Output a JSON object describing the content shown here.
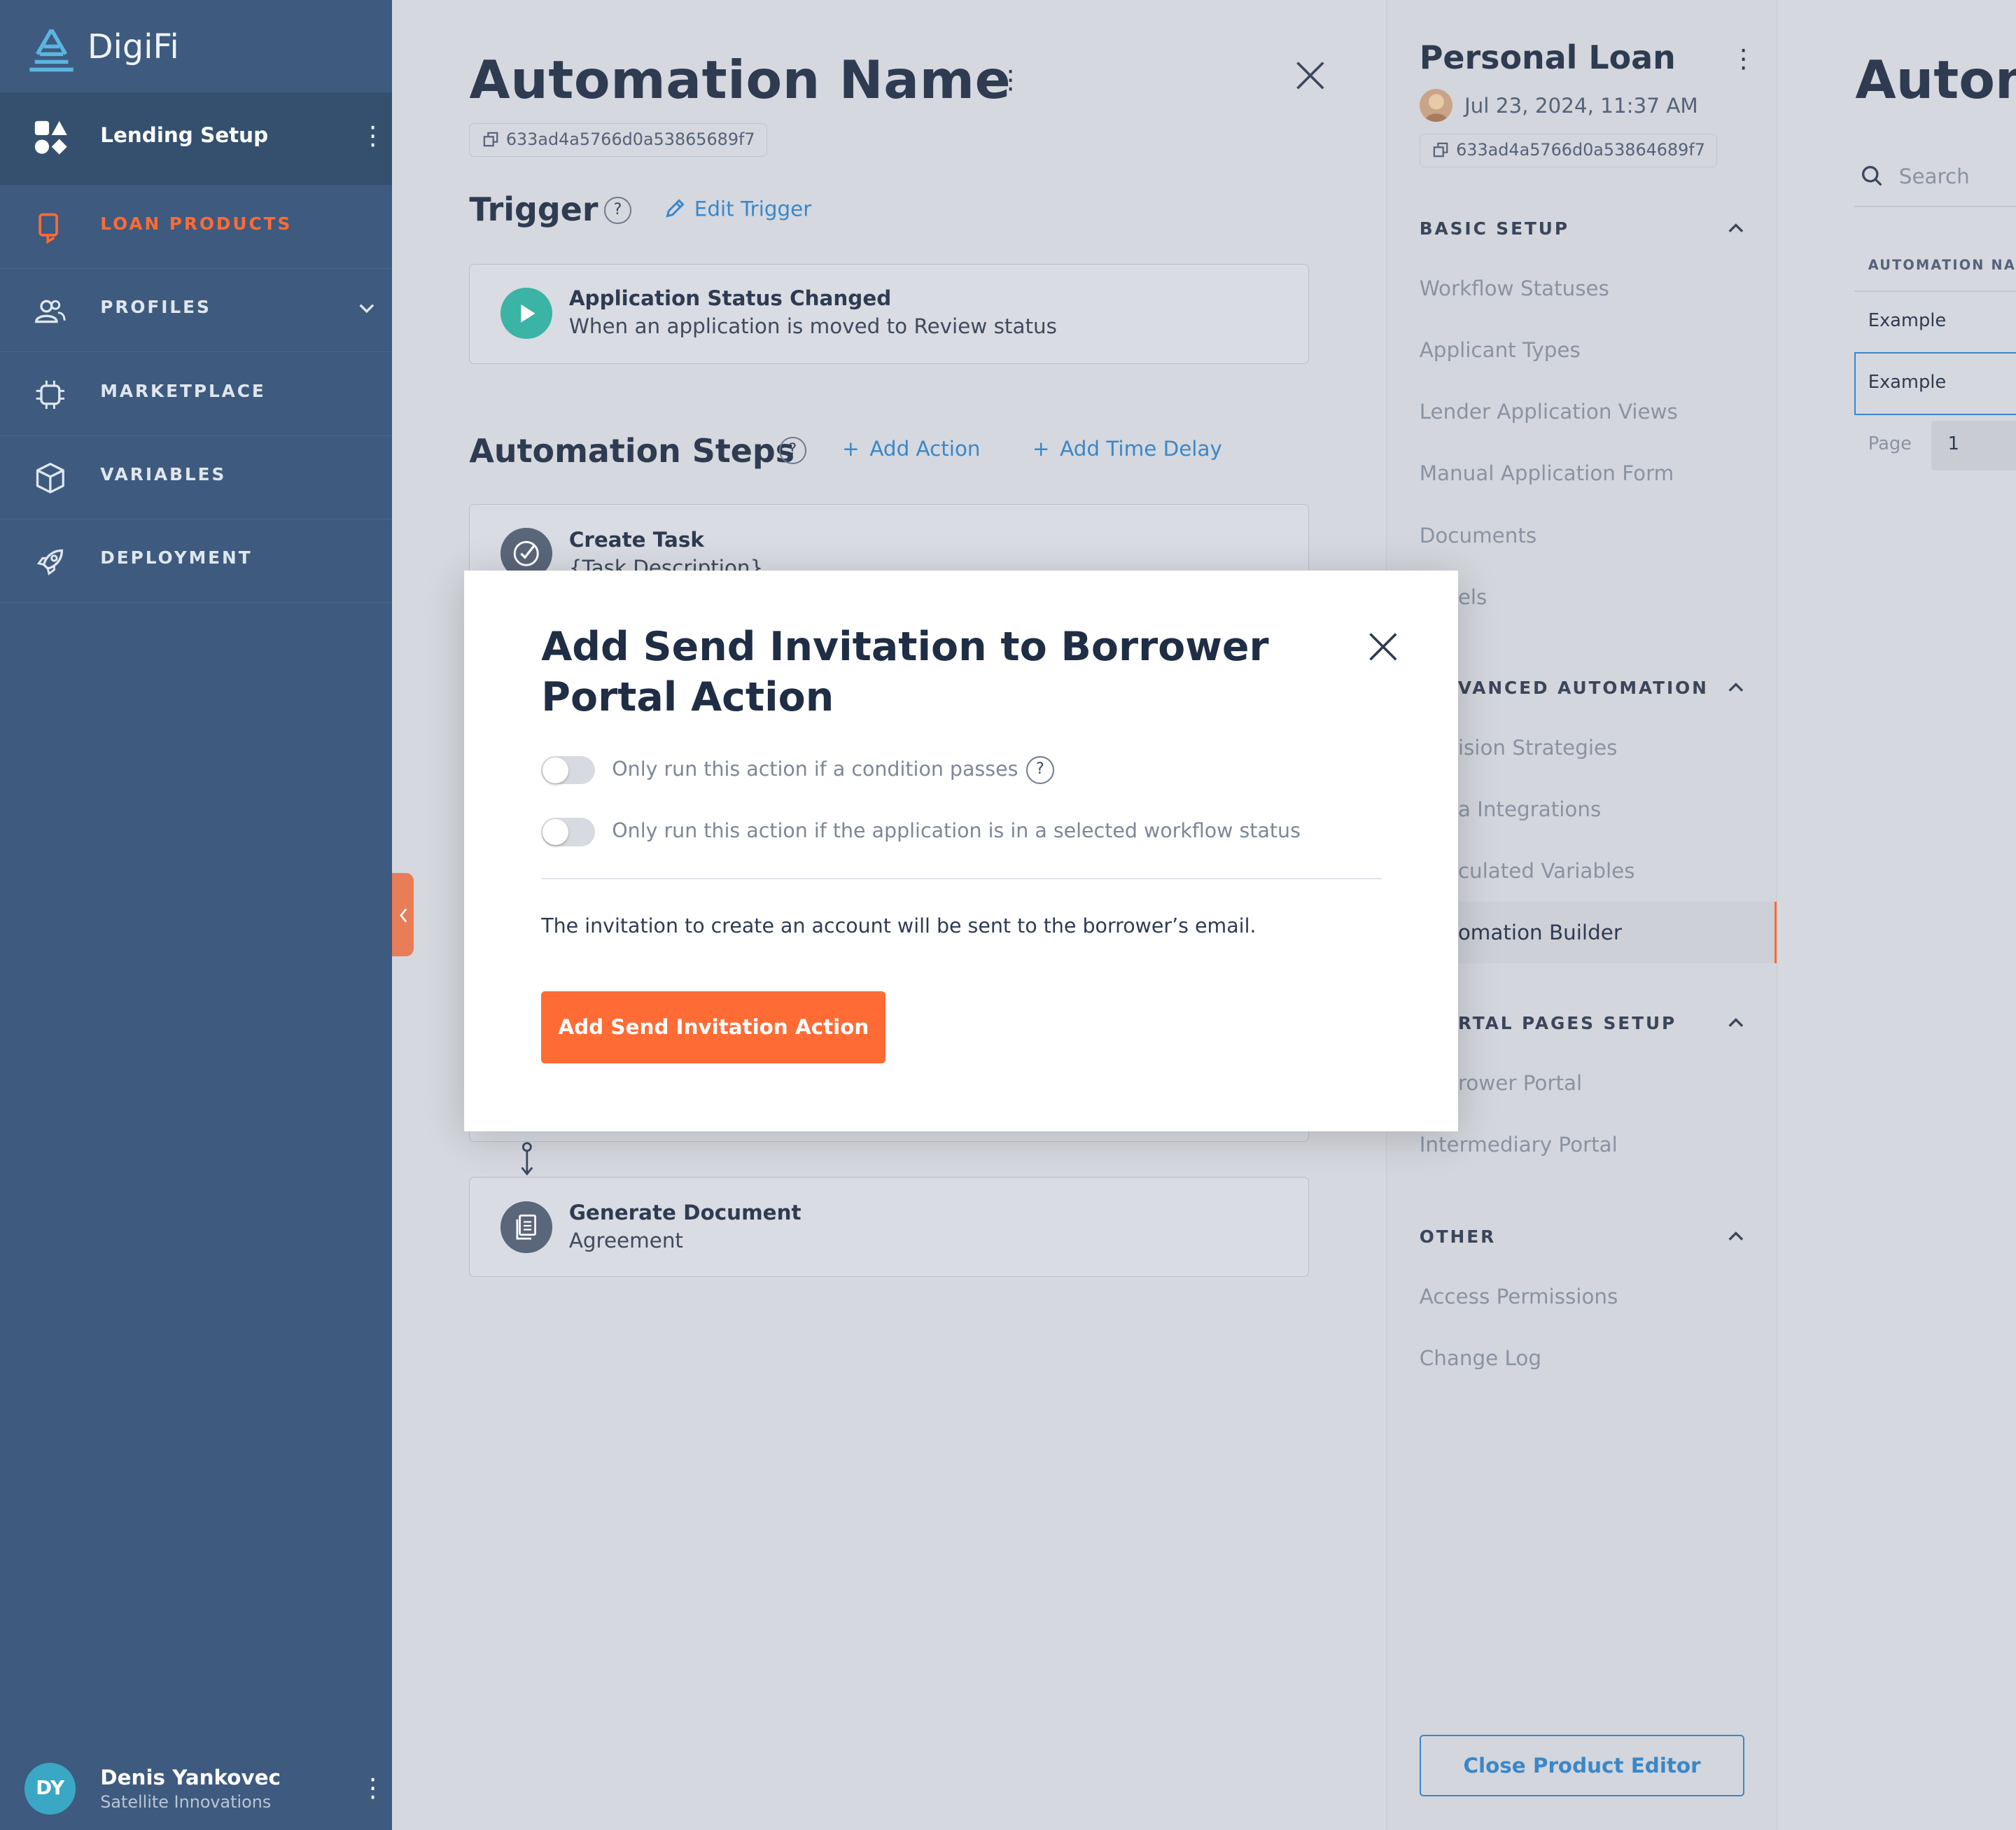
{
  "sidebar": {
    "brand": "DigiFi",
    "setup_label": "Lending Setup",
    "items": [
      {
        "label": "LOAN PRODUCTS",
        "active": true
      },
      {
        "label": "PROFILES"
      },
      {
        "label": "MARKETPLACE"
      },
      {
        "label": "VARIABLES"
      },
      {
        "label": "DEPLOYMENT"
      }
    ],
    "user": {
      "initials": "DY",
      "name": "Denis Yankovec",
      "org": "Satellite Innovations"
    }
  },
  "automation": {
    "title": "Automation Name",
    "id": "633ad4a5766d0a53865689f7",
    "trigger_heading": "Trigger",
    "edit_trigger": "Edit Trigger",
    "trigger_card": {
      "title": "Application Status Changed",
      "subtitle": "When an application is moved to Review status"
    },
    "steps_heading": "Automation Steps",
    "add_action": "Add Action",
    "add_time_delay": "Add Time Delay",
    "steps": [
      {
        "title": "Create Task",
        "subtitle": "{Task Description}"
      },
      {
        "title": "Generate Document",
        "subtitle": "Agreement"
      }
    ]
  },
  "product": {
    "title": "Personal Loan",
    "date": "Jul 23, 2024, 11:37 AM",
    "id": "633ad4a5766d0a53864689f7",
    "sections": {
      "basic": {
        "heading": "BASIC SETUP",
        "items": [
          "Workflow Statuses",
          "Applicant Types",
          "Lender Application Views",
          "Manual Application Form",
          "Documents",
          "els"
        ]
      },
      "advanced": {
        "heading": "VANCED AUTOMATION",
        "items": [
          "ision Strategies",
          "a Integrations",
          "culated Variables",
          "omation Builder"
        ]
      },
      "portal": {
        "heading": "RTAL PAGES SETUP",
        "items": [
          "rower Portal",
          "Intermediary Portal"
        ]
      },
      "other": {
        "heading": "OTHER",
        "items": [
          "Access Permissions",
          "Change Log"
        ]
      }
    },
    "close_button": "Close Product Editor"
  },
  "far_panel": {
    "title": "Autom",
    "search_placeholder": "Search",
    "column_header": "AUTOMATION NAM",
    "rows": [
      "Example",
      "Example"
    ],
    "page_label": "Page",
    "page_value": "1"
  },
  "modal": {
    "title": "Add Send Invitation to Borrower Portal Action",
    "toggle1_label": "Only run this action if a condition passes",
    "toggle2_label": "Only run this action if the application is in a selected workflow status",
    "description": "The invitation to create an account will be sent to the borrower’s email.",
    "submit": "Add Send Invitation Action"
  },
  "colors": {
    "sidebar": "#3e5a7e",
    "accent_orange": "#ff6b35",
    "link_blue": "#3a87c9",
    "teal": "#3bb3a5"
  }
}
